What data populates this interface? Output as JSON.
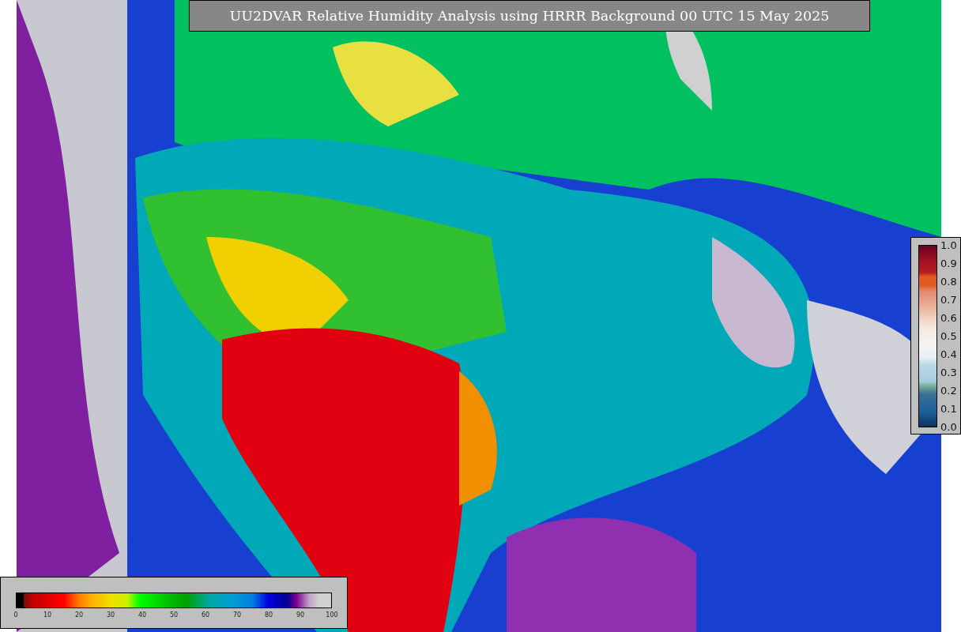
{
  "title": "UU2DVAR Relative Humidity Analysis using HRRR Background 00 UTC 15 May 2025",
  "colorbar_bottom": {
    "ticks": [
      "0",
      "10",
      "20",
      "30",
      "40",
      "50",
      "60",
      "70",
      "80",
      "90",
      "100"
    ]
  },
  "colorbar_right": {
    "ticks": [
      "1.0",
      "0.9",
      "0.8",
      "0.7",
      "0.6",
      "0.5",
      "0.4",
      "0.3",
      "0.2",
      "0.1",
      "0.0"
    ]
  }
}
